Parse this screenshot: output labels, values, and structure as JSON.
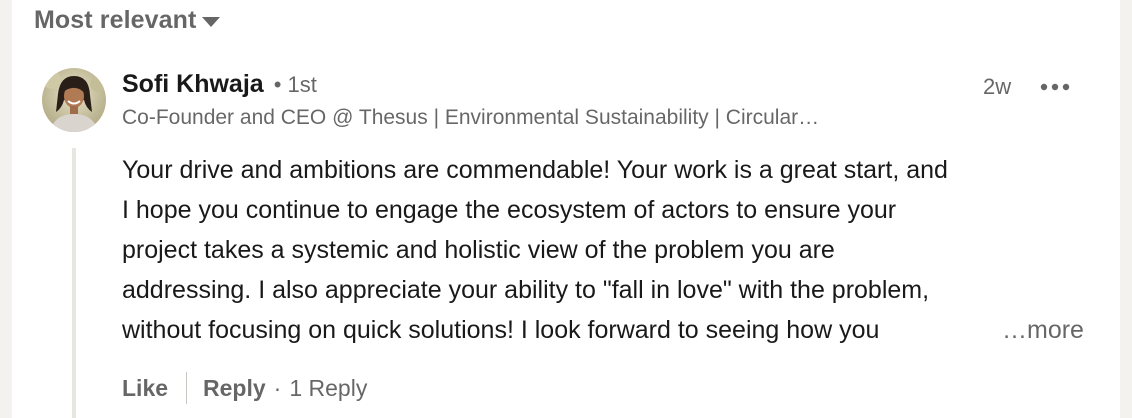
{
  "sort": {
    "label": "Most relevant",
    "icon": "caret-down-icon"
  },
  "comment": {
    "author": "Sofi Khwaja",
    "degree": "• 1st",
    "headline": "Co-Founder and CEO @ Thesus | Environmental Sustainability | Circular…",
    "timestamp": "2w",
    "more_icon": "ellipsis-icon",
    "lines": [
      "Your drive and ambitions are commendable! Your work is a great start, and",
      "I hope you continue to engage the ecosystem of actors to ensure your",
      "project takes a systemic and holistic view of the problem you are",
      "addressing. I also appreciate your ability to \"fall in love\" with the problem,",
      "without focusing on quick solutions! I look forward to seeing how you"
    ],
    "see_more": "…more"
  },
  "actions": {
    "like": "Like",
    "reply": "Reply",
    "separator": "·",
    "reply_count": "1 Reply"
  }
}
